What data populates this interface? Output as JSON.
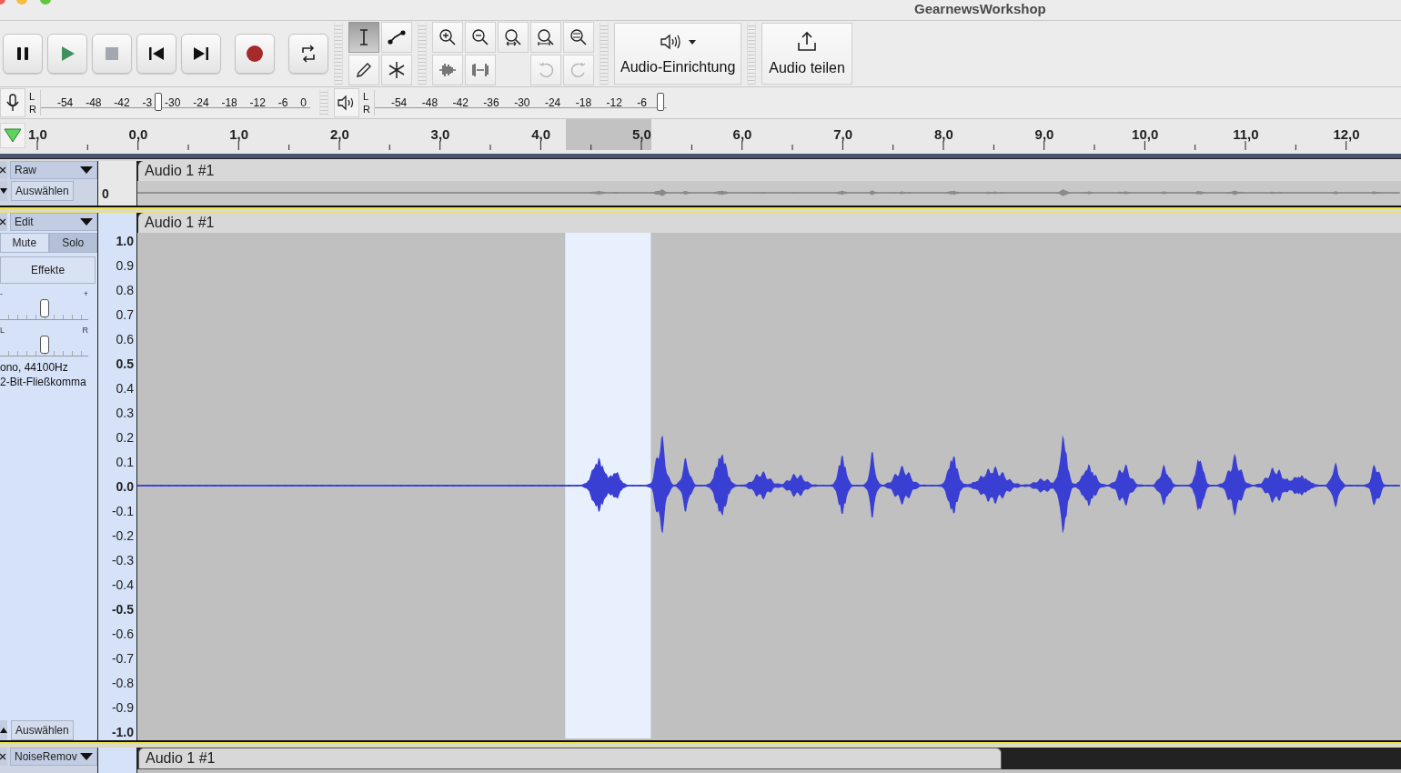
{
  "window": {
    "title": "GearnewsWorkshop"
  },
  "transport": [
    {
      "kind": "pause"
    },
    {
      "kind": "play"
    },
    {
      "kind": "stop"
    },
    {
      "kind": "skip-start"
    },
    {
      "kind": "skip-end"
    },
    {
      "kind": "record"
    },
    {
      "kind": "loop"
    }
  ],
  "tools": [
    {
      "kind": "select",
      "selected": true
    },
    {
      "kind": "envelope",
      "selected": false
    },
    {
      "kind": "draw",
      "selected": false
    },
    {
      "kind": "multi",
      "selected": false
    }
  ],
  "edit_tools": [
    {
      "kind": "zoom-in",
      "disabled": false
    },
    {
      "kind": "zoom-out",
      "disabled": false
    },
    {
      "kind": "fit-selection",
      "disabled": false
    },
    {
      "kind": "fit-project",
      "disabled": false
    },
    {
      "kind": "zoom-toggle",
      "disabled": false
    },
    {
      "kind": "trim",
      "disabled": false
    },
    {
      "kind": "silence",
      "disabled": false
    },
    {
      "kind": "undo",
      "disabled": true
    },
    {
      "kind": "redo",
      "disabled": true
    }
  ],
  "audio_setup": {
    "label": "Audio-Einrichtung"
  },
  "share": {
    "label": "Audio teilen"
  },
  "record_meter": {
    "channels": [
      "L",
      "R"
    ],
    "ticks": [
      "-54",
      "-48",
      "-42",
      "-3",
      "-30",
      "-24",
      "-18",
      "-12",
      "-6",
      "0"
    ],
    "level": 0.44
  },
  "play_meter": {
    "channels": [
      "L",
      "R"
    ],
    "ticks": [
      "-54",
      "-48",
      "-42",
      "-36",
      "-30",
      "-24",
      "-18",
      "-12",
      "-6"
    ],
    "level": 0.98
  },
  "timeline": {
    "labels": [
      "1,0",
      "0,0",
      "1,0",
      "2,0",
      "3,0",
      "4,0",
      "5,0",
      "6,0",
      "7,0",
      "8,0",
      "9,0",
      "10,0",
      "11,0",
      "12,0"
    ]
  },
  "tracks": [
    {
      "kind": "collapsed",
      "selected": false,
      "effect": "Raw",
      "select_button": "Auswählen",
      "ruler": [
        {
          "label": "0",
          "major": true
        }
      ],
      "title": "Audio 1 #1"
    },
    {
      "kind": "expanded",
      "selected": true,
      "effect": "Edit",
      "mute": {
        "label": "Mute",
        "on": false
      },
      "solo": {
        "label": "Solo",
        "on": true
      },
      "effects_button": "Effekte",
      "gain": {
        "minus": "-",
        "plus": "+",
        "level": 0.5
      },
      "pan": {
        "left": "L",
        "right": "R",
        "level": 0.5
      },
      "info": [
        "ono, 44100Hz",
        "2-Bit-Fließkomma"
      ],
      "select_button": "Auswählen",
      "title": "Audio 1 #1",
      "ruler": [
        {
          "label": "1.0",
          "major": true
        },
        {
          "label": "0.9",
          "major": false
        },
        {
          "label": "0.8",
          "major": false
        },
        {
          "label": "0.7",
          "major": false
        },
        {
          "label": "0.6",
          "major": false
        },
        {
          "label": "0.5",
          "major": true
        },
        {
          "label": "0.4",
          "major": false
        },
        {
          "label": "0.3",
          "major": false
        },
        {
          "label": "0.2",
          "major": false
        },
        {
          "label": "0.1",
          "major": false
        },
        {
          "label": "0.0",
          "major": true
        },
        {
          "label": "-0.1",
          "major": false
        },
        {
          "label": "-0.2",
          "major": false
        },
        {
          "label": "-0.3",
          "major": false
        },
        {
          "label": "-0.4",
          "major": false
        },
        {
          "label": "-0.5",
          "major": true
        },
        {
          "label": "-0.6",
          "major": false
        },
        {
          "label": "-0.7",
          "major": false
        },
        {
          "label": "-0.8",
          "major": false
        },
        {
          "label": "-0.9",
          "major": false
        },
        {
          "label": "-1.0",
          "major": true
        }
      ]
    },
    {
      "kind": "partial",
      "selected": false,
      "effect": "NoiseRemov",
      "title": "Audio 1 #1"
    }
  ]
}
